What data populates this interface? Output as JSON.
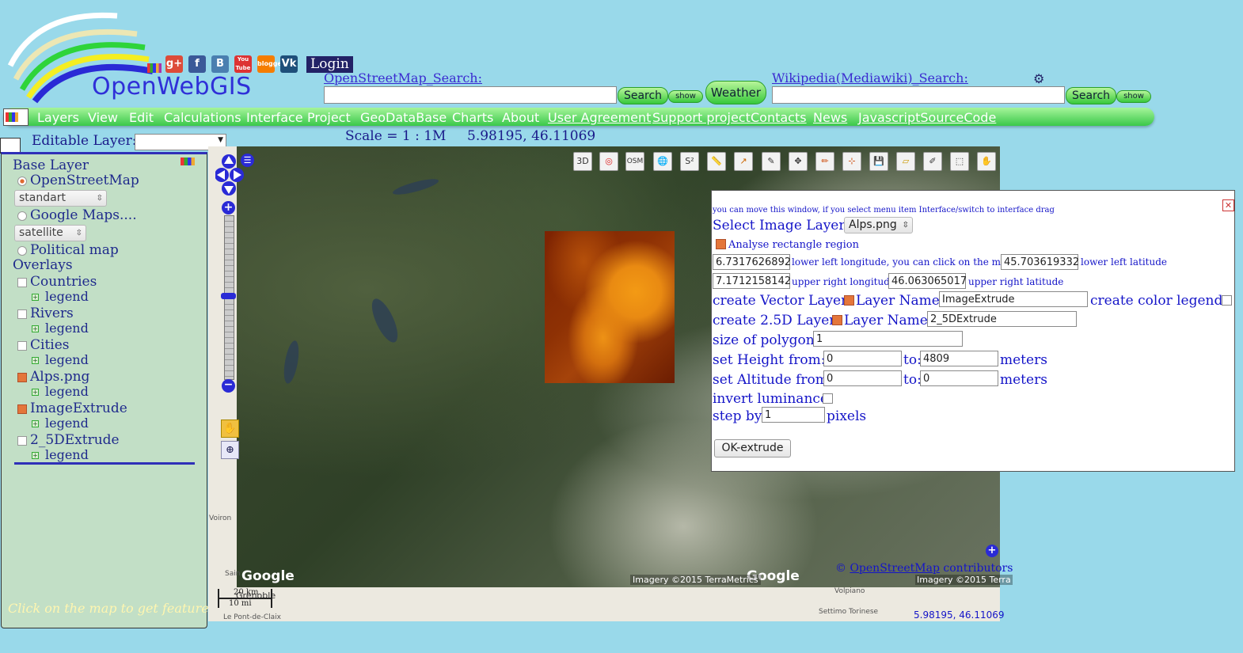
{
  "brand": {
    "name": "OpenWebGIS",
    "login": "Login"
  },
  "social_icons": [
    "g+",
    "f",
    "B",
    "You Tube",
    "blogger",
    "Vk"
  ],
  "search": {
    "osm_title": "OpenStreetMap_Search:",
    "osm_button": "Search",
    "osm_show": "show",
    "weather_button": "Weather",
    "wiki_title": "Wikipedia(Mediawiki)_Search:",
    "wiki_button": "Search",
    "wiki_show": "show"
  },
  "menu": {
    "items": [
      "Layers",
      "View",
      "Edit",
      "Calculations",
      "Interface",
      "Project",
      "GeoDataBase",
      "Charts",
      "About"
    ],
    "links": [
      "User Agreement",
      "Support project",
      "Contacts",
      "News",
      "JavascriptSourceCode"
    ]
  },
  "toolbar": {
    "editable_label": "Editable Layer:",
    "scale": "Scale = 1 : 1M",
    "coords": "5.98195, 46.11069"
  },
  "layers_panel": {
    "base_title": "Base Layer",
    "osm": "OpenStreetMap",
    "osm_style": "standart",
    "google": "Google Maps....",
    "google_style": "satellite",
    "political": "Political map",
    "overlays_title": "Overlays",
    "legend_label": "legend",
    "overlays": [
      {
        "name": "Countries",
        "checked": false
      },
      {
        "name": "Rivers",
        "checked": false
      },
      {
        "name": "Cities",
        "checked": false
      },
      {
        "name": "Alps.png",
        "checked": true
      },
      {
        "name": "ImageExtrude",
        "checked": true
      },
      {
        "name": "2_5DExtrude",
        "checked": false
      }
    ],
    "hint": "Click on the map to get feature"
  },
  "map": {
    "google_logo_left": "Google",
    "google_logo_right": "Google",
    "imagery_credit": "Imagery ©2015 TerraMetrics",
    "imagery_credit_2": "Imagery ©2015 Terra",
    "osm_credit_prefix": "©",
    "osm_credit_link": "OpenStreetMap",
    "osm_credit_suffix": "contributors",
    "scale_km": "20 km",
    "scale_mi": "10 mi",
    "coords_bottom": "5.98195, 46.11069",
    "place_labels": [
      "Grenoble",
      "Voiron",
      "Le Pont-de-Claix",
      "Volpiano",
      "Settimo Torinese",
      "Sain"
    ]
  },
  "popup": {
    "move_hint": "you can move this window, if you select menu item Interface/switch to interface drag",
    "select_label": "Select Image Layer:",
    "select_value": "Alps.png",
    "analyse_label": "Analyse rectangle region",
    "ll_lon": "6.7317626892",
    "ll_lon_label": "lower left longitude, you can click on the map",
    "ll_lat": "45.703619332",
    "ll_lat_label": "lower left latitude",
    "ur_lon": "7.1712158142",
    "ur_lon_label": "upper right longitude",
    "ur_lat": "46.063065017",
    "ur_lat_label": "upper right latitude",
    "vector_label": "create Vector Layer",
    "layer_name_label": "Layer Name:",
    "vector_name": "ImageExtrude",
    "color_legend_label": "create color legend:",
    "layer25_label": "create 2.5D Layer",
    "layer25_name": "2_5DExtrude",
    "poly_size_label": "size of polygons",
    "poly_size": "1",
    "height_label": "set Height",
    "from_label": "from:",
    "to_label": "to:",
    "height_from": "0",
    "height_to": "4809",
    "meters": "meters",
    "altitude_label": "set Altitude from:",
    "alt_from": "0",
    "alt_to": "0",
    "invert_label": "invert luminance",
    "step_label": "step by:",
    "step_value": "1",
    "pixels": "pixels",
    "ok_button": "OK-extrude",
    "close": "x"
  }
}
